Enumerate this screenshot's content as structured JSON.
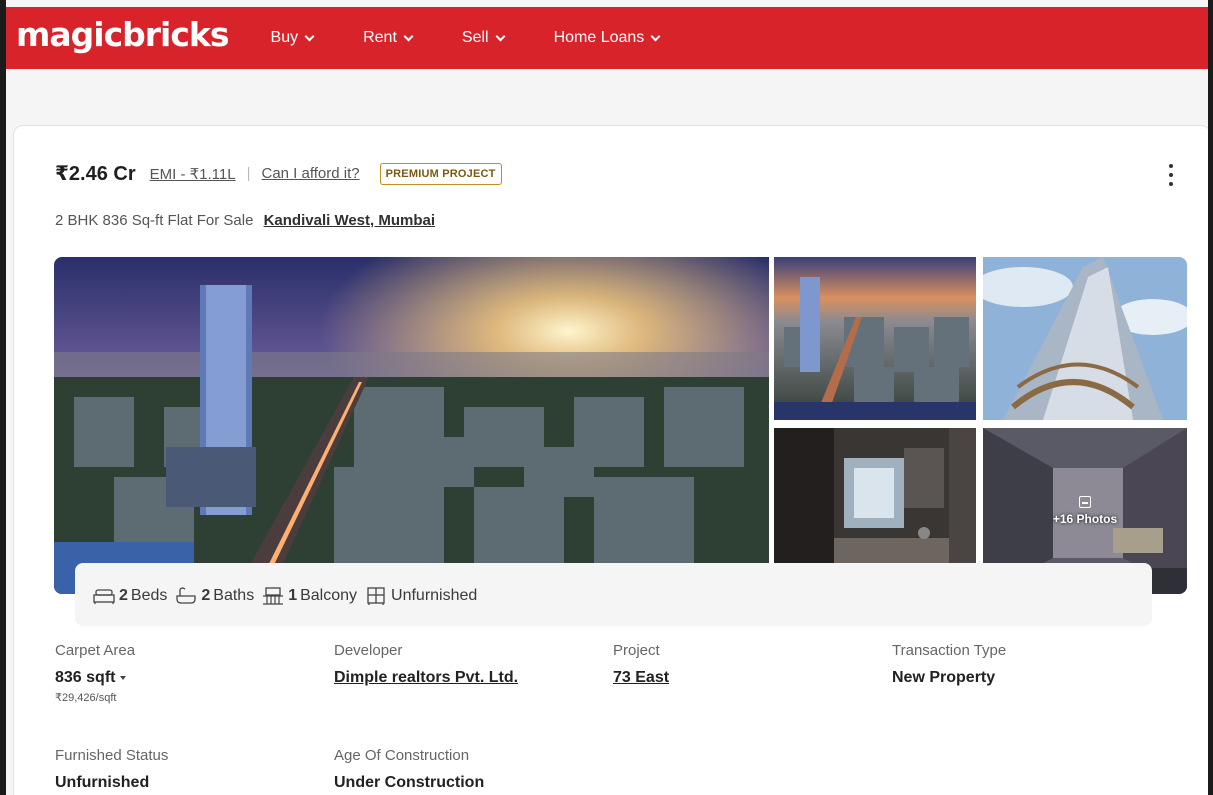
{
  "header": {
    "logo": "magicbricks",
    "nav": [
      "Buy",
      "Rent",
      "Sell",
      "Home Loans"
    ]
  },
  "listing": {
    "price": "₹2.46 Cr",
    "emi": "EMI - ₹1.11L",
    "separator": "|",
    "afford": "Can I afford it?",
    "badge": "PREMIUM PROJECT",
    "title": "2 BHK 836 Sq-ft Flat For Sale",
    "location": "Kandivali West, Mumbai",
    "photos_label": "+16 Photos"
  },
  "amenities": {
    "beds_count": "2",
    "beds_label": "Beds",
    "baths_count": "2",
    "baths_label": "Baths",
    "balcony_count": "1",
    "balcony_label": "Balcony",
    "furnishing": "Unfurnished"
  },
  "details": {
    "carpet_area_label": "Carpet Area",
    "carpet_area_value": "836 sqft",
    "price_per_sqft": "₹29,426/sqft",
    "developer_label": "Developer",
    "developer_value": "Dimple realtors Pvt. Ltd.",
    "project_label": "Project",
    "project_value": "73 East",
    "transaction_label": "Transaction Type",
    "transaction_value": "New Property",
    "furnished_label": "Furnished Status",
    "furnished_value": "Unfurnished",
    "age_label": "Age Of Construction",
    "age_value": "Under Construction"
  },
  "colors": {
    "brand": "#d8232a",
    "badge_border": "#c28c1f"
  }
}
